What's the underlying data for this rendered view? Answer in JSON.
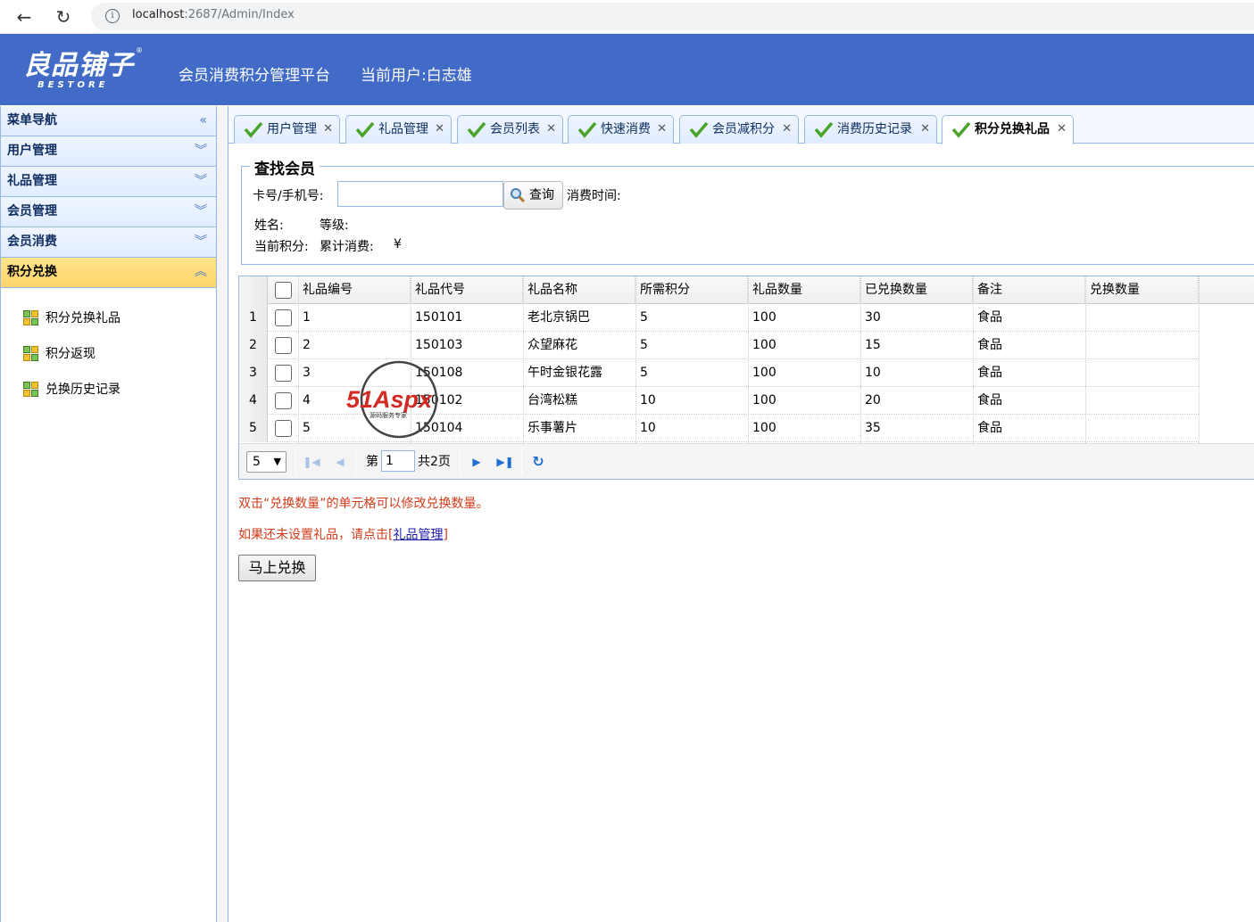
{
  "browser": {
    "url_host": "localhost",
    "url_rest": ":2687/Admin/Index"
  },
  "header": {
    "logo_cn": "良品铺子",
    "logo_en": "BESTORE",
    "logo_reg": "®",
    "title": "会员消费积分管理平台",
    "user": "当前用户:白志雄"
  },
  "sidebar": {
    "sections": [
      {
        "label": "菜单导航",
        "chevron": "«"
      },
      {
        "label": "用户管理",
        "chevron": "︾"
      },
      {
        "label": "礼品管理",
        "chevron": "︾"
      },
      {
        "label": "会员管理",
        "chevron": "︾"
      },
      {
        "label": "会员消费",
        "chevron": "︾"
      },
      {
        "label": "积分兑换",
        "chevron": "︽"
      }
    ],
    "links": [
      "积分兑换礼品",
      "积分返现",
      "兑换历史记录"
    ]
  },
  "tabs": [
    "用户管理",
    "礼品管理",
    "会员列表",
    "快速消费",
    "会员减积分",
    "消费历史记录",
    "积分兑换礼品"
  ],
  "search": {
    "legend": "查找会员",
    "card_label": "卡号/手机号:",
    "card_value": "",
    "query_button": "查询",
    "time_label": "消费时间:",
    "name_label": "姓名:",
    "level_label": "等级:",
    "points_label": "当前积分:",
    "total_label": "累计消费:",
    "currency": "¥"
  },
  "grid": {
    "columns": [
      "礼品编号",
      "礼品代号",
      "礼品名称",
      "所需积分",
      "礼品数量",
      "已兑换数量",
      "备注",
      "兑换数量"
    ],
    "rows": [
      {
        "num": "1",
        "id": "1",
        "code": "150101",
        "name": "老北京锅巴",
        "points": "5",
        "qty": "100",
        "redeemed": "30",
        "note": "食品",
        "exchange": ""
      },
      {
        "num": "2",
        "id": "2",
        "code": "150103",
        "name": "众望麻花",
        "points": "5",
        "qty": "100",
        "redeemed": "15",
        "note": "食品",
        "exchange": ""
      },
      {
        "num": "3",
        "id": "3",
        "code": "150108",
        "name": "午时金银花露",
        "points": "5",
        "qty": "100",
        "redeemed": "10",
        "note": "食品",
        "exchange": ""
      },
      {
        "num": "4",
        "id": "4",
        "code": "150102",
        "name": "台湾松糕",
        "points": "10",
        "qty": "100",
        "redeemed": "20",
        "note": "食品",
        "exchange": ""
      },
      {
        "num": "5",
        "id": "5",
        "code": "150104",
        "name": "乐事薯片",
        "points": "10",
        "qty": "100",
        "redeemed": "35",
        "note": "食品",
        "exchange": ""
      }
    ],
    "pager": {
      "page_size": "5",
      "page_prefix": "第",
      "page_value": "1",
      "page_total": "共2页"
    }
  },
  "watermark": {
    "main": "51Aspx",
    "sub": "源码服务专家"
  },
  "notes": {
    "line1": "双击“兑换数量”的单元格可以修改兑换数量。",
    "line2_prefix": "如果还未设置礼品，请点击[",
    "line2_link": "礼品管理",
    "line2_suffix": "]"
  },
  "redeem_button": "马上兑换",
  "colors": {
    "header": "#416bc6",
    "accent_border": "#95b8e7",
    "note_red": "#d03a1a",
    "active_section": "#ffd56a"
  }
}
